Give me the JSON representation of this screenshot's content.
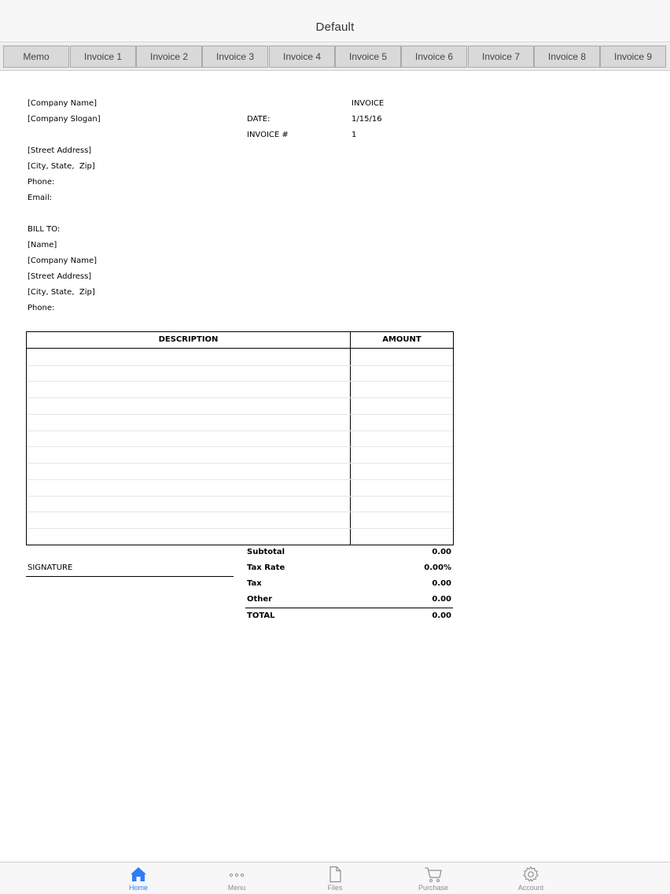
{
  "nav": {
    "title": "Default"
  },
  "tabs": [
    "Memo",
    "Invoice 1",
    "Invoice 2",
    "Invoice 3",
    "Invoice 4",
    "Invoice 5",
    "Invoice 6",
    "Invoice 7",
    "Invoice 8",
    "Invoice 9"
  ],
  "invoice": {
    "company_name": "[Company Name]",
    "company_slogan": "[Company Slogan]",
    "street_address": "[Street Address]",
    "city_state_zip": "[City, State,  Zip]",
    "phone_label": "Phone:",
    "email_label": "Email:",
    "heading": "INVOICE",
    "date_label": "DATE:",
    "date_value": "1/15/16",
    "number_label": "INVOICE #",
    "number_value": "1",
    "bill_to": {
      "label": "BILL TO:",
      "name": "[Name]",
      "company_name": "[Company Name]",
      "street_address": "[Street Address]",
      "city_state_zip": "[City, State,  Zip]",
      "phone_label": "Phone:"
    },
    "table": {
      "description_header": "DESCRIPTION",
      "amount_header": "AMOUNT"
    },
    "signature_label": "SIGNATURE",
    "totals": {
      "subtotal_label": "Subtotal",
      "subtotal_value": "0.00",
      "tax_rate_label": "Tax Rate",
      "tax_rate_value": "0.00%",
      "tax_label": "Tax",
      "tax_value": "0.00",
      "other_label": "Other",
      "other_value": "0.00",
      "total_label": "TOTAL",
      "total_value": "0.00"
    }
  },
  "tabbar": {
    "items": [
      {
        "label": "Home",
        "icon": "home-icon",
        "active": true
      },
      {
        "label": "Menu",
        "icon": "more-icon",
        "active": false
      },
      {
        "label": "Files",
        "icon": "file-icon",
        "active": false
      },
      {
        "label": "Purchase",
        "icon": "cart-icon",
        "active": false
      },
      {
        "label": "Account",
        "icon": "gear-icon",
        "active": false
      }
    ]
  },
  "colors": {
    "accent": "#2f7cf6",
    "inactive": "#8e8e93"
  }
}
